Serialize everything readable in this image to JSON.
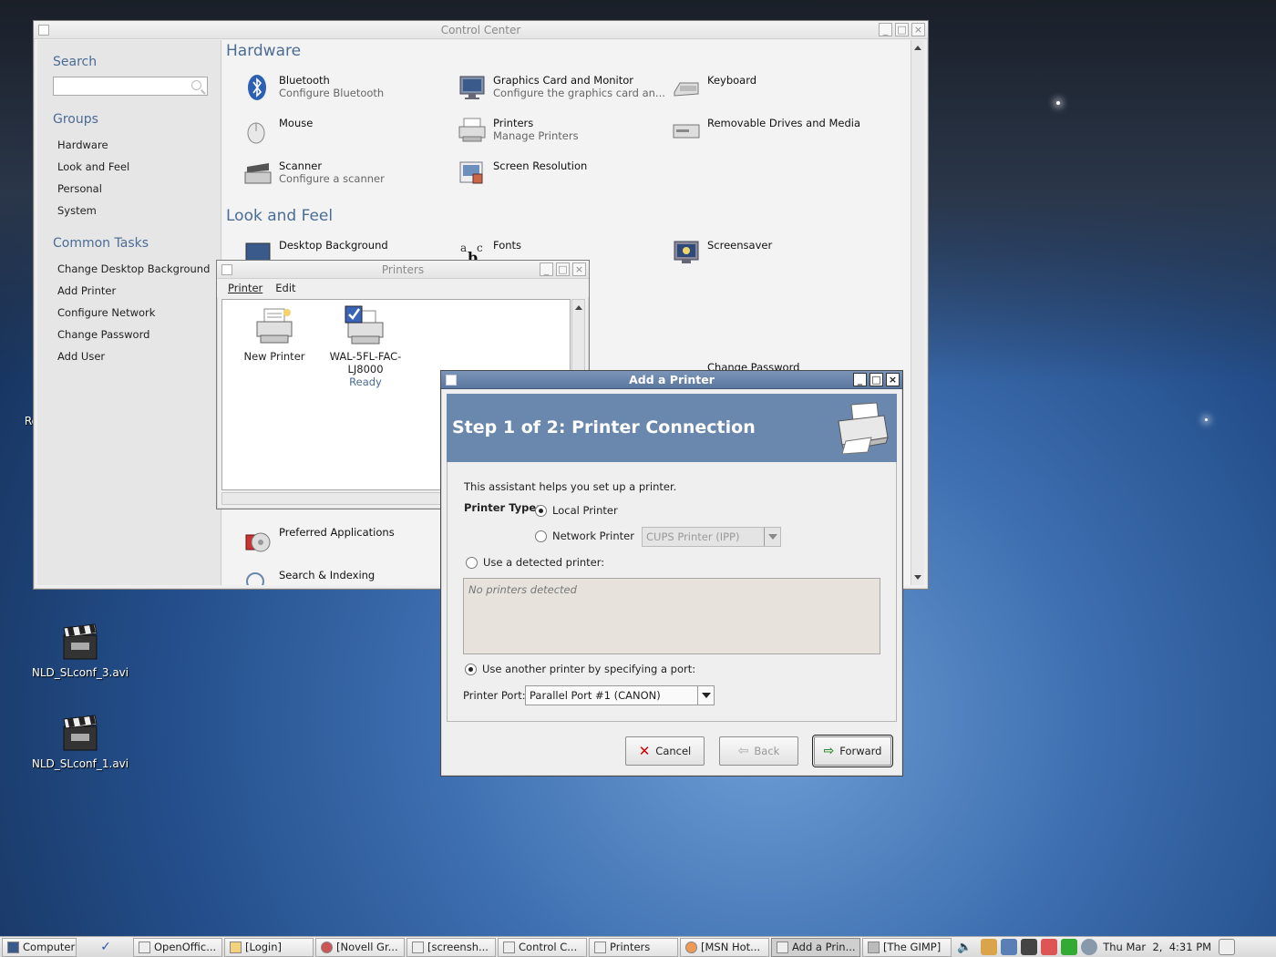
{
  "control_center": {
    "title": "Control Center",
    "search_label": "Search",
    "search_value": "",
    "groups_label": "Groups",
    "groups": [
      "Hardware",
      "Look and Feel",
      "Personal",
      "System"
    ],
    "common_tasks_label": "Common Tasks",
    "common_tasks": [
      "Change Desktop Background",
      "Add Printer",
      "Configure Network",
      "Change Password",
      "Add User"
    ],
    "hardware_title": "Hardware",
    "hardware_items": [
      {
        "name": "Bluetooth",
        "desc": "Configure Bluetooth"
      },
      {
        "name": "Graphics Card and Monitor",
        "desc": "Configure the graphics card an..."
      },
      {
        "name": "Keyboard",
        "desc": ""
      },
      {
        "name": "Mouse",
        "desc": ""
      },
      {
        "name": "Printers",
        "desc": "Manage Printers"
      },
      {
        "name": "Removable Drives and Media",
        "desc": ""
      },
      {
        "name": "Scanner",
        "desc": "Configure a scanner"
      },
      {
        "name": "Screen Resolution",
        "desc": ""
      }
    ],
    "look_feel_title": "Look and Feel",
    "look_feel_items": [
      {
        "name": "Desktop Background"
      },
      {
        "name": "Fonts"
      },
      {
        "name": "Screensaver"
      }
    ],
    "partial_items": {
      "change_password": "Change Password",
      "preferred_apps": "Preferred Applications",
      "search_indexing": "Search & Indexing"
    }
  },
  "printers_window": {
    "title": "Printers",
    "menu": [
      "Printer",
      "Edit"
    ],
    "items": [
      {
        "name": "New Printer",
        "status": ""
      },
      {
        "name": "WAL-5FL-FAC-\nLJ8000",
        "name_line1": "WAL-5FL-FAC-",
        "name_line2": "LJ8000",
        "status": "Ready"
      }
    ]
  },
  "add_printer": {
    "title": "Add a Printer",
    "step_title": "Step 1 of 2: Printer Connection",
    "intro": "This assistant helps you set up a printer.",
    "printer_type_label": "Printer Type:",
    "local_printer": "Local Printer",
    "network_printer": "Network Printer",
    "network_type_value": "CUPS Printer (IPP)",
    "use_detected": "Use a detected printer:",
    "no_printers": "No printers detected",
    "use_another": "Use another printer by specifying a port:",
    "port_label": "Printer Port:",
    "port_value": "Parallel Port #1 (CANON)",
    "cancel": "Cancel",
    "back": "Back",
    "forward": "Forward"
  },
  "desktop": {
    "icons": [
      "NLD_SLconf_3.avi",
      "NLD_SLconf_1.avi"
    ],
    "partial_label": "Re"
  },
  "taskbar": {
    "computer": "Computer",
    "tasks": [
      "OpenOffic...",
      "[Login]",
      "[Novell Gr...",
      "[screensh...",
      "Control C...",
      "Printers",
      "[MSN Hot...",
      "Add a Prin...",
      "[The GIMP]"
    ],
    "clock": "Thu Mar  2,  4:31 PM"
  },
  "colors": {
    "accent": "#4a6c95",
    "dialog_title": "#5b779e",
    "wizard_header": "#6a87ad"
  }
}
